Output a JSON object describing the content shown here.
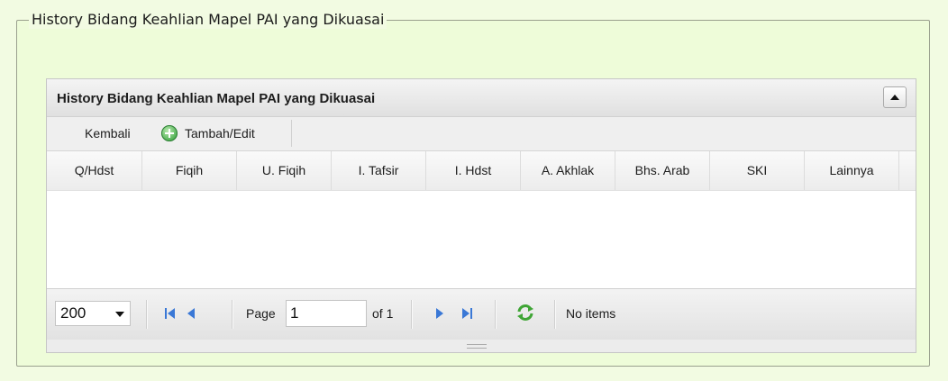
{
  "fieldset": {
    "legend": "History Bidang Keahlian Mapel PAI yang Dikuasai"
  },
  "grid": {
    "title": "History Bidang Keahlian Mapel PAI yang Dikuasai",
    "toolbar": {
      "back_label": "Kembali",
      "add_edit_label": "Tambah/Edit"
    },
    "columns": [
      "Q/Hdst",
      "Fiqih",
      "U. Fiqih",
      "I. Tafsir",
      "I. Hdst",
      "A. Akhlak",
      "Bhs. Arab",
      "SKI",
      "Lainnya"
    ],
    "rows": [],
    "pager": {
      "page_size": "200",
      "page_label": "Page",
      "page_value": "1",
      "of_label": "of 1",
      "status": "No items"
    }
  },
  "icons": {
    "add": "plus-circle-icon",
    "first": "first-page-icon",
    "prev": "prev-page-icon",
    "next": "next-page-icon",
    "last": "last-page-icon",
    "refresh": "refresh-icon",
    "collapse": "collapse-arrow-icon"
  },
  "colors": {
    "page_bg": "#f2fbe2",
    "nav_blue": "#3a78d6",
    "refresh_green": "#3fa535"
  }
}
